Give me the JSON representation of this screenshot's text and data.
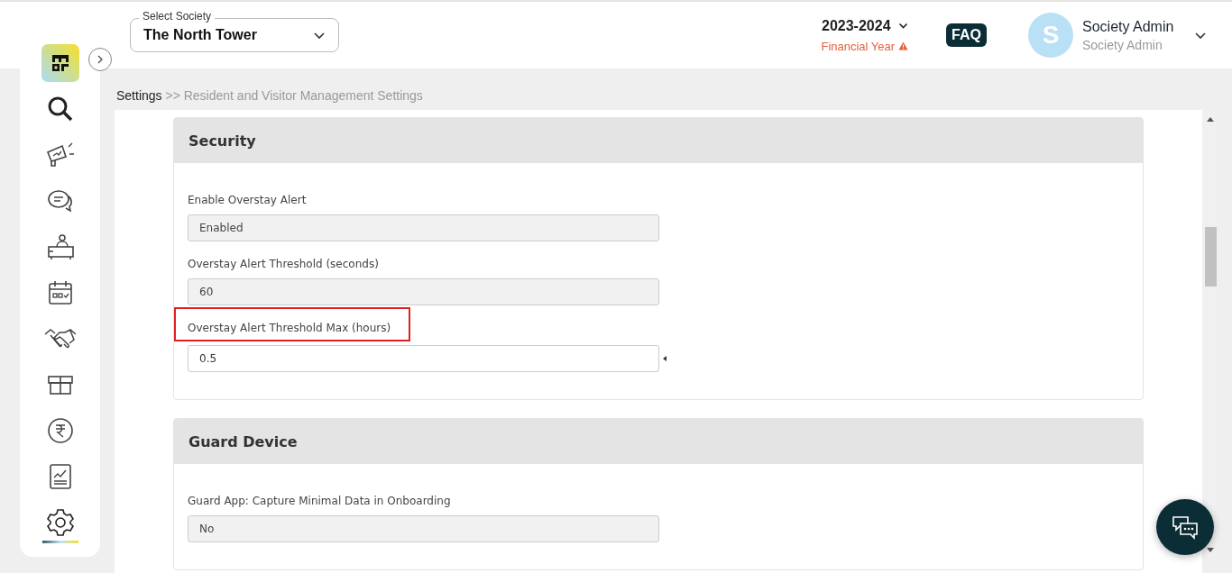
{
  "header": {
    "society_label": "Select Society",
    "society_value": "The North Tower",
    "year": "2023-2024",
    "year_caption": "Financial Year",
    "faq": "FAQ",
    "avatar_letter": "S",
    "user_name": "Society Admin",
    "user_role": "Society Admin"
  },
  "sidebar": {
    "items": [
      {
        "kind": "search",
        "selected": false
      },
      {
        "kind": "megaphone",
        "selected": false
      },
      {
        "kind": "chat",
        "selected": false
      },
      {
        "kind": "desk",
        "selected": false
      },
      {
        "kind": "calendar",
        "selected": false
      },
      {
        "kind": "handshake",
        "selected": false
      },
      {
        "kind": "box",
        "selected": false
      },
      {
        "kind": "rupee",
        "selected": false
      },
      {
        "kind": "report",
        "selected": false
      },
      {
        "kind": "gear",
        "selected": true
      }
    ]
  },
  "breadcrumb": {
    "root": "Settings",
    "rest": ">> Resident and Visitor Management Settings"
  },
  "sections": [
    {
      "title": "Security",
      "fields": [
        {
          "label": "Enable Overstay Alert",
          "value": "Enabled",
          "disabled": true,
          "highlighted": false
        },
        {
          "label": "Overstay Alert Threshold (seconds)",
          "value": "60",
          "disabled": true,
          "highlighted": false
        },
        {
          "label": "Overstay Alert Threshold Max (hours)",
          "value": "0.5",
          "disabled": false,
          "highlighted": true
        }
      ]
    },
    {
      "title": "Guard Device",
      "fields": [
        {
          "label": "Guard App: Capture Minimal Data in Onboarding",
          "value": "No",
          "disabled": true,
          "highlighted": false
        }
      ]
    }
  ]
}
